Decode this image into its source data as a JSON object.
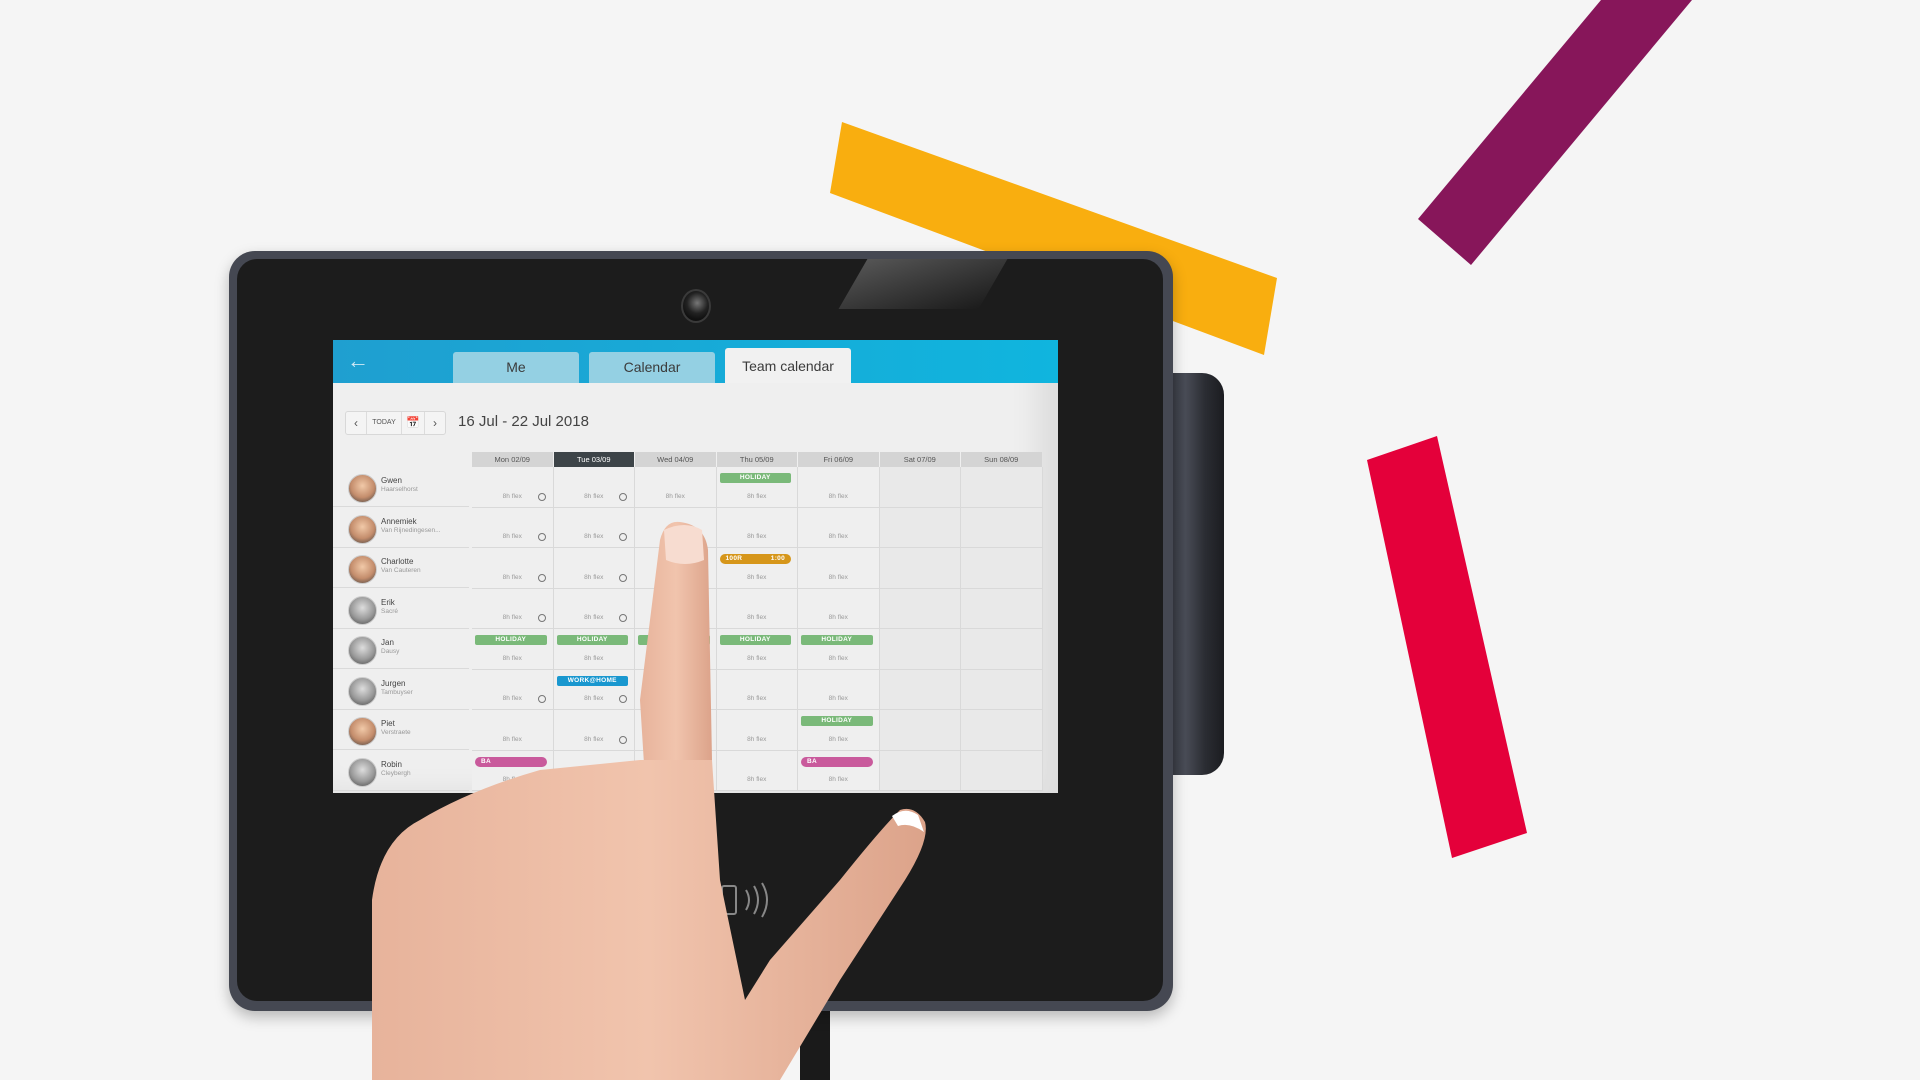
{
  "colors": {
    "background": "#f5f5f5",
    "yellow_bar": "#f9ae0f",
    "purple_bar": "#87165a",
    "red_bar": "#e4003a",
    "header_blue": "#1aaed9",
    "holiday": "#7ab979",
    "work_home": "#1997cf",
    "orange_badge": "#d6961a",
    "ba_pink": "#c95a9c"
  },
  "app": {
    "back_icon": "arrow-left-icon",
    "tabs": [
      {
        "label": "Me",
        "active": false
      },
      {
        "label": "Calendar",
        "active": false
      },
      {
        "label": "Team calendar",
        "active": true
      }
    ],
    "nav": {
      "prev_icon": "chevron-left-icon",
      "today_label": "TODAY",
      "calendar_icon": "calendar-icon",
      "next_icon": "chevron-right-icon"
    },
    "date_range": "16 Jul - 22 Jul 2018"
  },
  "calendar": {
    "days": [
      {
        "label": "Mon 02/09",
        "today": false
      },
      {
        "label": "Tue 03/09",
        "today": true
      },
      {
        "label": "Wed 04/09",
        "today": false
      },
      {
        "label": "Thu 05/09",
        "today": false
      },
      {
        "label": "Fri 06/09",
        "today": false
      },
      {
        "label": "Sat 07/09",
        "today": false
      },
      {
        "label": "Sun 08/09",
        "today": false
      }
    ],
    "flex_label": "8h flex",
    "people": [
      {
        "first": "Gwen",
        "last": "Haarselhorst",
        "cells": [
          {
            "flex": true,
            "clock": true
          },
          {
            "flex": true,
            "clock": true
          },
          {
            "flex": true
          },
          {
            "flex": true,
            "badge": {
              "type": "holiday",
              "label": "HOLIDAY"
            }
          },
          {
            "flex": true
          },
          {},
          {}
        ]
      },
      {
        "first": "Annemiek",
        "last": "Van Rijnedingesen...",
        "cells": [
          {
            "flex": true,
            "clock": true
          },
          {
            "flex": true,
            "clock": true
          },
          {},
          {
            "flex": true
          },
          {
            "flex": true
          },
          {},
          {}
        ]
      },
      {
        "first": "Charlotte",
        "last": "Van Cauteren",
        "cells": [
          {
            "flex": true,
            "clock": true
          },
          {
            "flex": true,
            "clock": true
          },
          {},
          {
            "flex": true,
            "badge": {
              "type": "orange",
              "label": "100R",
              "right": "1:00"
            }
          },
          {
            "flex": true
          },
          {},
          {}
        ]
      },
      {
        "first": "Erik",
        "last": "Sacré",
        "cells": [
          {
            "flex": true,
            "clock": true
          },
          {
            "flex": true,
            "clock": true
          },
          {},
          {
            "flex": true
          },
          {
            "flex": true
          },
          {},
          {}
        ]
      },
      {
        "first": "Jan",
        "last": "Dausy",
        "cells": [
          {
            "flex": true,
            "badge": {
              "type": "holiday",
              "label": "HOLIDAY"
            }
          },
          {
            "flex": true,
            "badge": {
              "type": "holiday",
              "label": "HOLIDAY"
            }
          },
          {
            "badge": {
              "type": "holiday",
              "label": "HOLIDAY"
            }
          },
          {
            "flex": true,
            "badge": {
              "type": "holiday",
              "label": "HOLIDAY"
            }
          },
          {
            "flex": true,
            "badge": {
              "type": "holiday",
              "label": "HOLIDAY"
            }
          },
          {},
          {}
        ]
      },
      {
        "first": "Jurgen",
        "last": "Tambuyser",
        "cells": [
          {
            "flex": true,
            "clock": true
          },
          {
            "flex": true,
            "clock": true,
            "badge": {
              "type": "workhome",
              "label": "WORK@HOME"
            }
          },
          {},
          {
            "flex": true
          },
          {
            "flex": true
          },
          {},
          {}
        ]
      },
      {
        "first": "Piet",
        "last": "Verstraete",
        "cells": [
          {
            "flex": true
          },
          {
            "flex": true,
            "clock": true
          },
          {},
          {
            "flex": true
          },
          {
            "flex": true,
            "badge": {
              "type": "holiday",
              "label": "HOLIDAY"
            }
          },
          {},
          {}
        ]
      },
      {
        "first": "Robin",
        "last": "Cleybergh",
        "cells": [
          {
            "flex": true,
            "badge": {
              "type": "ba",
              "label": "BA"
            }
          },
          {},
          {},
          {
            "flex": true
          },
          {
            "flex": true,
            "badge": {
              "type": "ba",
              "label": "BA"
            }
          },
          {},
          {}
        ]
      }
    ]
  },
  "device": {
    "camera_icon": "camera-icon",
    "nfc_icon": "nfc-contactless-icon"
  }
}
